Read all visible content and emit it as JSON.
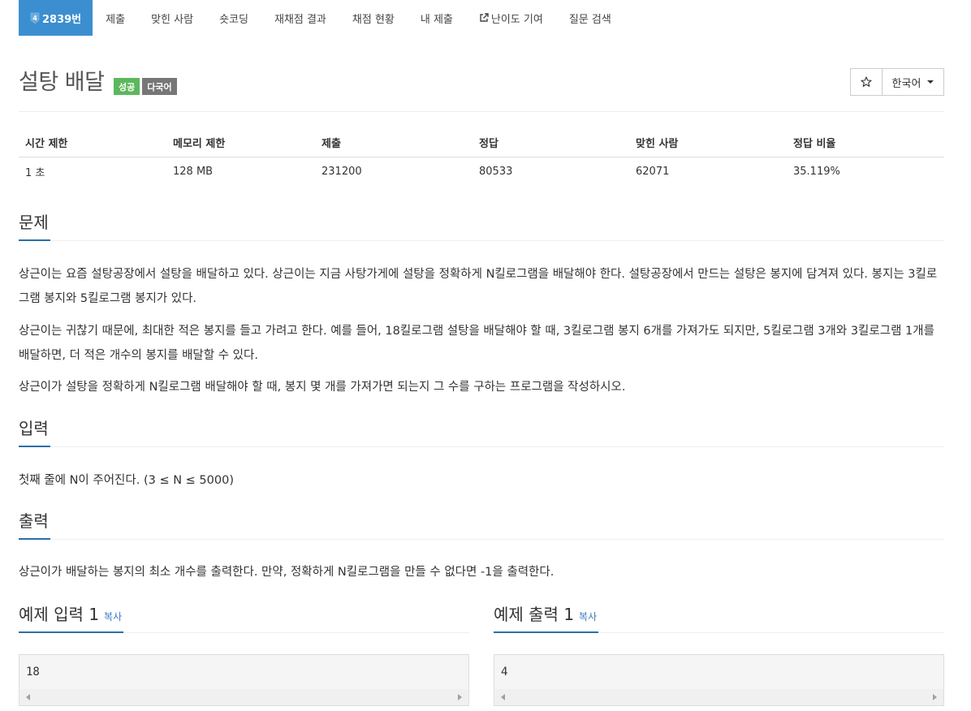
{
  "nav": {
    "tabs": [
      {
        "label": "2839번",
        "level": "4"
      },
      {
        "label": "제출"
      },
      {
        "label": "맞힌 사람"
      },
      {
        "label": "숏코딩"
      },
      {
        "label": "재채점 결과"
      },
      {
        "label": "채점 현황"
      },
      {
        "label": "내 제출"
      },
      {
        "label": "난이도 기여",
        "icon": "external-link-icon"
      },
      {
        "label": "질문 검색"
      }
    ]
  },
  "problem": {
    "title": "설탕 배달",
    "badges": [
      "성공",
      "다국어"
    ],
    "language_select": "한국어",
    "star_icon": "star-outline-icon"
  },
  "info": {
    "headers": [
      "시간 제한",
      "메모리 제한",
      "제출",
      "정답",
      "맞힌 사람",
      "정답 비율"
    ],
    "values": [
      "1 초",
      "128 MB",
      "231200",
      "80533",
      "62071",
      "35.119%"
    ]
  },
  "sections": {
    "problem": {
      "heading": "문제",
      "paragraphs": [
        "상근이는 요즘 설탕공장에서 설탕을 배달하고 있다. 상근이는 지금 사탕가게에 설탕을 정확하게 N킬로그램을 배달해야 한다. 설탕공장에서 만드는 설탕은 봉지에 담겨져 있다. 봉지는 3킬로그램 봉지와 5킬로그램 봉지가 있다.",
        "상근이는 귀찮기 때문에, 최대한 적은 봉지를 들고 가려고 한다. 예를 들어, 18킬로그램 설탕을 배달해야 할 때, 3킬로그램 봉지 6개를 가져가도 되지만, 5킬로그램 3개와 3킬로그램 1개를 배달하면, 더 적은 개수의 봉지를 배달할 수 있다.",
        "상근이가 설탕을 정확하게 N킬로그램 배달해야 할 때, 봉지 몇 개를 가져가면 되는지 그 수를 구하는 프로그램을 작성하시오."
      ]
    },
    "input": {
      "heading": "입력",
      "text": "첫째 줄에 N이 주어진다. (3 ≤ N ≤ 5000)"
    },
    "output": {
      "heading": "출력",
      "text": "상근이가 배달하는 봉지의 최소 개수를 출력한다. 만약, 정확하게 N킬로그램을 만들 수 없다면 -1을 출력한다."
    },
    "sample_input": {
      "heading": "예제 입력 1",
      "copy": "복사",
      "value": "18"
    },
    "sample_output": {
      "heading": "예제 출력 1",
      "copy": "복사",
      "value": "4"
    }
  },
  "colors": {
    "accent": "#3b8fd0",
    "success": "#5cb85c",
    "neutral_badge": "#777777",
    "section_underline": "#2a6fa8",
    "link": "#3a7bbf"
  }
}
